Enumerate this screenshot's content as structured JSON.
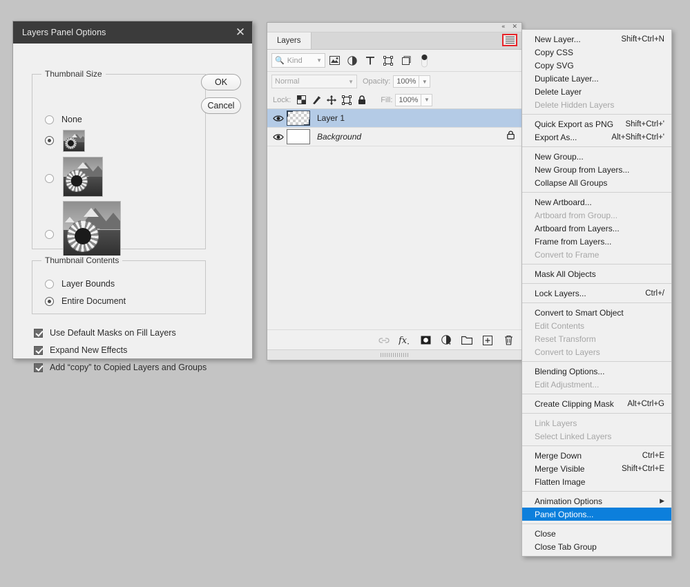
{
  "dialog": {
    "title": "Layers Panel Options",
    "close_icon": "close-icon",
    "buttons": {
      "ok": "OK",
      "cancel": "Cancel"
    },
    "thumbnail_size": {
      "legend": "Thumbnail Size",
      "options": [
        {
          "label": "None",
          "selected": false
        },
        {
          "label": "",
          "selected": true
        },
        {
          "label": "",
          "selected": false
        },
        {
          "label": "",
          "selected": false
        }
      ]
    },
    "thumbnail_contents": {
      "legend": "Thumbnail Contents",
      "options": [
        {
          "label": "Layer Bounds",
          "selected": false
        },
        {
          "label": "Entire Document",
          "selected": true
        }
      ]
    },
    "checkboxes": [
      {
        "label": "Use Default Masks on Fill Layers",
        "checked": true
      },
      {
        "label": "Expand New Effects",
        "checked": true
      },
      {
        "label": "Add “copy” to Copied Layers and Groups",
        "checked": true
      }
    ]
  },
  "layers_panel": {
    "tab_label": "Layers",
    "topbar": {
      "collapse_icon": "«",
      "close_icon": "✕"
    },
    "menu_button_icon": "hamburger-menu-icon",
    "filter": {
      "kind_label": "Kind",
      "search_icon": "search-icon",
      "chevron_icon": "chevron-down-icon",
      "type_icons": [
        "image-filter-icon",
        "adjustment-filter-icon",
        "type-filter-icon",
        "shape-filter-icon",
        "smart-object-filter-icon",
        "filter-toggle-icon"
      ]
    },
    "blend": {
      "mode": "Normal",
      "opacity_label": "Opacity:",
      "opacity_value": "100%"
    },
    "lock": {
      "label": "Lock:",
      "icons": [
        "lock-transparent-pixels-icon",
        "lock-image-pixels-icon",
        "lock-position-icon",
        "lock-artboard-nesting-icon",
        "lock-all-icon"
      ],
      "fill_label": "Fill:",
      "fill_value": "100%"
    },
    "layers": [
      {
        "name": "Layer 1",
        "selected": true,
        "visible": true,
        "locked": false,
        "thumb": "transparent",
        "italic": false
      },
      {
        "name": "Background",
        "selected": false,
        "visible": true,
        "locked": true,
        "thumb": "white",
        "italic": true
      }
    ],
    "bottom_icons": [
      "link-layers-icon",
      "layer-style-fx-icon",
      "add-layer-mask-icon",
      "new-adjustment-layer-icon",
      "new-group-icon",
      "new-layer-icon",
      "delete-layer-icon"
    ]
  },
  "context_menu": {
    "items": [
      {
        "label": "New Layer...",
        "shortcut": "Shift+Ctrl+N",
        "disabled": false,
        "highlighted": false
      },
      {
        "label": "Copy CSS",
        "shortcut": "",
        "disabled": false,
        "highlighted": false
      },
      {
        "label": "Copy SVG",
        "shortcut": "",
        "disabled": false,
        "highlighted": false
      },
      {
        "label": "Duplicate Layer...",
        "shortcut": "",
        "disabled": false,
        "highlighted": false
      },
      {
        "label": "Delete Layer",
        "shortcut": "",
        "disabled": false,
        "highlighted": false
      },
      {
        "label": "Delete Hidden Layers",
        "shortcut": "",
        "disabled": true,
        "highlighted": false
      },
      {
        "separator": true
      },
      {
        "label": "Quick Export as PNG",
        "shortcut": "Shift+Ctrl+'",
        "disabled": false,
        "highlighted": false
      },
      {
        "label": "Export As...",
        "shortcut": "Alt+Shift+Ctrl+'",
        "disabled": false,
        "highlighted": false
      },
      {
        "separator": true
      },
      {
        "label": "New Group...",
        "shortcut": "",
        "disabled": false,
        "highlighted": false
      },
      {
        "label": "New Group from Layers...",
        "shortcut": "",
        "disabled": false,
        "highlighted": false
      },
      {
        "label": "Collapse All Groups",
        "shortcut": "",
        "disabled": false,
        "highlighted": false
      },
      {
        "separator": true
      },
      {
        "label": "New Artboard...",
        "shortcut": "",
        "disabled": false,
        "highlighted": false
      },
      {
        "label": "Artboard from Group...",
        "shortcut": "",
        "disabled": true,
        "highlighted": false
      },
      {
        "label": "Artboard from Layers...",
        "shortcut": "",
        "disabled": false,
        "highlighted": false
      },
      {
        "label": "Frame from Layers...",
        "shortcut": "",
        "disabled": false,
        "highlighted": false
      },
      {
        "label": "Convert to Frame",
        "shortcut": "",
        "disabled": true,
        "highlighted": false
      },
      {
        "separator": true
      },
      {
        "label": "Mask All Objects",
        "shortcut": "",
        "disabled": false,
        "highlighted": false
      },
      {
        "separator": true
      },
      {
        "label": "Lock Layers...",
        "shortcut": "Ctrl+/",
        "disabled": false,
        "highlighted": false
      },
      {
        "separator": true
      },
      {
        "label": "Convert to Smart Object",
        "shortcut": "",
        "disabled": false,
        "highlighted": false
      },
      {
        "label": "Edit Contents",
        "shortcut": "",
        "disabled": true,
        "highlighted": false
      },
      {
        "label": "Reset Transform",
        "shortcut": "",
        "disabled": true,
        "highlighted": false
      },
      {
        "label": "Convert to Layers",
        "shortcut": "",
        "disabled": true,
        "highlighted": false
      },
      {
        "separator": true
      },
      {
        "label": "Blending Options...",
        "shortcut": "",
        "disabled": false,
        "highlighted": false
      },
      {
        "label": "Edit Adjustment...",
        "shortcut": "",
        "disabled": true,
        "highlighted": false
      },
      {
        "separator": true
      },
      {
        "label": "Create Clipping Mask",
        "shortcut": "Alt+Ctrl+G",
        "disabled": false,
        "highlighted": false
      },
      {
        "separator": true
      },
      {
        "label": "Link Layers",
        "shortcut": "",
        "disabled": true,
        "highlighted": false
      },
      {
        "label": "Select Linked Layers",
        "shortcut": "",
        "disabled": true,
        "highlighted": false
      },
      {
        "separator": true
      },
      {
        "label": "Merge Down",
        "shortcut": "Ctrl+E",
        "disabled": false,
        "highlighted": false
      },
      {
        "label": "Merge Visible",
        "shortcut": "Shift+Ctrl+E",
        "disabled": false,
        "highlighted": false
      },
      {
        "label": "Flatten Image",
        "shortcut": "",
        "disabled": false,
        "highlighted": false
      },
      {
        "separator": true
      },
      {
        "label": "Animation Options",
        "shortcut": "",
        "disabled": false,
        "highlighted": false,
        "submenu": true
      },
      {
        "label": "Panel Options...",
        "shortcut": "",
        "disabled": false,
        "highlighted": true
      },
      {
        "separator": true
      },
      {
        "label": "Close",
        "shortcut": "",
        "disabled": false,
        "highlighted": false
      },
      {
        "label": "Close Tab Group",
        "shortcut": "",
        "disabled": false,
        "highlighted": false
      }
    ]
  },
  "colors": {
    "accent": "#0c7fdc",
    "selection": "#b4cbe6",
    "highlight_box": "#e8252a",
    "titlebar": "#3b3b3b",
    "panel_bg": "#f0f0f0",
    "desktop": "#c4c4c4"
  }
}
